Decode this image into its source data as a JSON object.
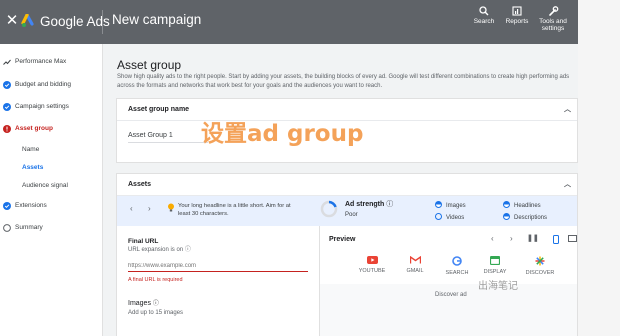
{
  "header": {
    "brand": "Google Ads",
    "title": "New campaign",
    "tools": [
      {
        "label": "Search",
        "icon": "search-icon"
      },
      {
        "label": "Reports",
        "icon": "reports-icon"
      },
      {
        "label": "Tools and settings",
        "icon": "wrench-icon"
      }
    ]
  },
  "sidebar": {
    "items": [
      {
        "label": "Performance Max",
        "icon": "trend-icon"
      },
      {
        "label": "Budget and bidding",
        "icon": "check-circle-icon"
      },
      {
        "label": "Campaign settings",
        "icon": "check-circle-icon"
      },
      {
        "label": "Asset group",
        "icon": "error-icon"
      },
      {
        "label": "Extensions",
        "icon": "check-circle-icon"
      },
      {
        "label": "Summary",
        "icon": "empty-circle-icon"
      }
    ],
    "subitems": [
      "Name",
      "Assets",
      "Audience signal"
    ]
  },
  "main": {
    "title": "Asset group",
    "description": "Show high quality ads to the right people. Start by adding your assets, the building blocks of every ad. Google will test different combinations to create high performing ads across the formats and networks that work best for your goals and the audiences you want to reach."
  },
  "asset_group_card": {
    "header": "Asset group name",
    "value": "Asset Group 1",
    "overlay_text": "设置ad group"
  },
  "assets_card": {
    "header": "Assets",
    "tip": "Your long headline is a little short. Aim for at least 30 characters.",
    "ad_strength_label": "Ad strength",
    "ad_strength_value": "Poor",
    "checklist": [
      "Images",
      "Headlines",
      "Videos",
      "Descriptions"
    ],
    "final_url_label": "Final URL",
    "url_expansion": "URL expansion is on",
    "url_placeholder": "https://www.example.com",
    "url_error": "A final URL is required",
    "images_label": "Images",
    "images_hint": "Add up to 15 images",
    "preview_label": "Preview",
    "channels": [
      "YOUTUBE",
      "GMAIL",
      "SEARCH",
      "DISPLAY",
      "DISCOVER"
    ],
    "preview_caption": "Discover ad"
  },
  "watermark": "出海笔记",
  "colors": {
    "topbar": "#5f6368",
    "accent_blue": "#1a73e8",
    "error_red": "#c5221f",
    "overlay_orange": "#f4a259"
  }
}
